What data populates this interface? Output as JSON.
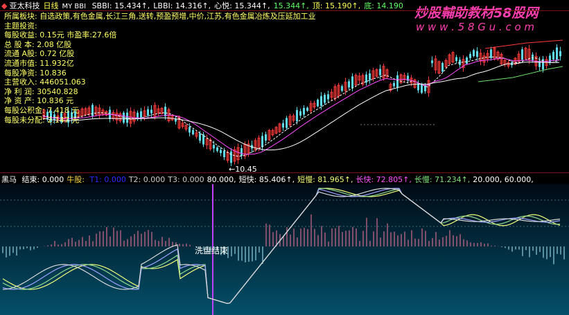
{
  "colors": {
    "bg": "#000000",
    "up": "#ff3b3b",
    "down": "#5fd8e8",
    "ma_white": "#ffffff",
    "ma_yellow": "#f2e85c",
    "ma_magenta": "#ff4aff",
    "ma_green": "#6fe06f",
    "panel_line_top": "#9b2b2b",
    "osc_line_a": "#f3ff79",
    "osc_line_b": "#8fd98f",
    "osc_line_c": "#a0a0ff",
    "cursor": "#c040ff",
    "hist_pos": "#ff7aa0",
    "hist_neg": "#aef2ff"
  },
  "header": {
    "name": "亚太科技",
    "period": "日线",
    "indicator_name": "MY BBI",
    "items": [
      {
        "label": "SBBI:",
        "value": "15.434"
      },
      {
        "label": "LBBI:",
        "value": "14.316"
      },
      {
        "label": "心悦:",
        "value": "15.344"
      },
      {
        "label": "",
        "value": "15.344"
      },
      {
        "label": "顶:",
        "value": "15.190"
      },
      {
        "label": "底:",
        "value": "14.190"
      }
    ]
  },
  "watermark": {
    "brand": "炒股輔助教材58股网",
    "url": "w w w . 5 8 G u . c o m"
  },
  "info_panel": {
    "lines": [
      "所属板块: 自选政策,有色金属,长江三角,送转,预盈预增,中价,江苏,有色金属冶炼及压延加工业",
      "主题投资:",
      "每股收益: 0.15元  市盈率:27.6倍",
      "总 股 本: 2.08  亿股",
      "流通 A股: 0.72  亿股",
      "流通市值: 11.932亿",
      "每股净资: 10.836",
      "主营收入: 446051.063",
      "净 利 润: 30540.828",
      "净 资 产: 10.836 元",
      "每股公积金: 7.418 元",
      "每股未分配: 2.147 元"
    ]
  },
  "low_label": "←10.45",
  "indicator_bar": {
    "title": "黑马",
    "items": [
      {
        "label": "结束:",
        "value": "0.000",
        "color": "#ffffff"
      },
      {
        "label": "牛股:",
        "value": "",
        "color": "#ffdd44"
      },
      {
        "label": "T1:",
        "value": "0.000",
        "color": "#2a2aff"
      },
      {
        "label": "T2:",
        "value": "0.000",
        "color": "#cccccc"
      },
      {
        "label": "T3:",
        "value": "0.000",
        "color": "#cccccc"
      },
      {
        "label": "",
        "value": "80.000,",
        "color": "#ffffff"
      },
      {
        "label": "短快:",
        "value": "85.406↑,",
        "color": "#ffffff"
      },
      {
        "label": "短慢:",
        "value": "81.965↑,",
        "color": "#f3ff79"
      },
      {
        "label": "长快:",
        "value": "72.805↑,",
        "color": "#ff55ff"
      },
      {
        "label": "长慢:",
        "value": "71.234↑,",
        "color": "#7fe27f"
      },
      {
        "label": "",
        "value": "20.000, 60.000,",
        "color": "#ffffff"
      }
    ]
  },
  "wash_label": "洗盘结束"
}
